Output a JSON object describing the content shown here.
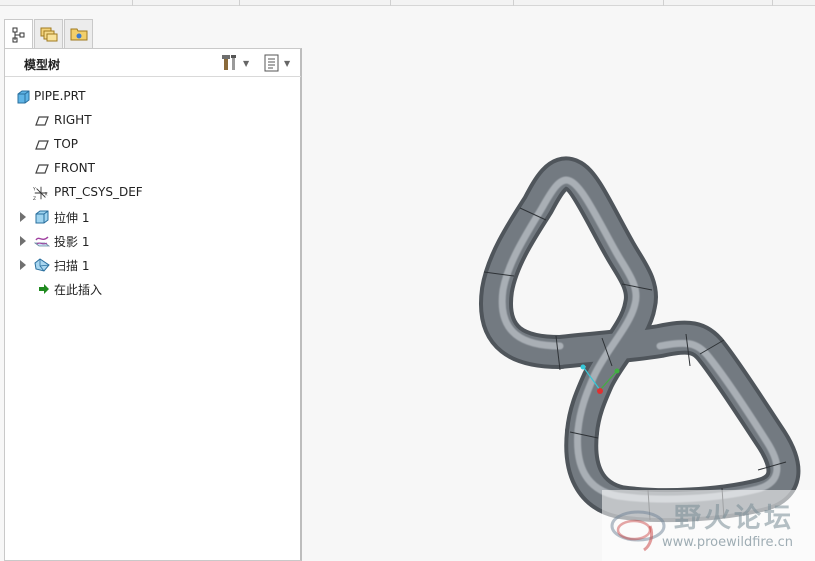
{
  "panel": {
    "title": "模型树"
  },
  "tabs": [
    {
      "icon": "model-tree-icon"
    },
    {
      "icon": "folder-browser-icon"
    },
    {
      "icon": "favorites-icon"
    }
  ],
  "header_buttons": [
    {
      "icon": "settings-tools-icon"
    },
    {
      "icon": "show-columns-icon"
    }
  ],
  "tree": {
    "root": {
      "label": "PIPE.PRT",
      "icon": "part-icon"
    },
    "items": [
      {
        "label": "RIGHT",
        "icon": "datum-plane-icon",
        "expandable": false
      },
      {
        "label": "TOP",
        "icon": "datum-plane-icon",
        "expandable": false
      },
      {
        "label": "FRONT",
        "icon": "datum-plane-icon",
        "expandable": false
      },
      {
        "label": "PRT_CSYS_DEF",
        "icon": "coordinate-system-icon",
        "expandable": false
      },
      {
        "label": "拉伸 1",
        "icon": "extrude-icon",
        "expandable": true
      },
      {
        "label": "投影 1",
        "icon": "projected-curve-icon",
        "expandable": true
      },
      {
        "label": "扫描 1",
        "icon": "sweep-icon",
        "expandable": true
      },
      {
        "label": "在此插入",
        "icon": "insert-here-icon",
        "expandable": false
      }
    ]
  },
  "watermark": {
    "title": "野火论坛",
    "url": "www.proewildfire.cn"
  },
  "colors": {
    "pipe": "#6f757c",
    "pipe_highlight": "#b7bcc1",
    "insert_arrow": "#1f8a1f",
    "part_icon": "#4aa3d8"
  }
}
